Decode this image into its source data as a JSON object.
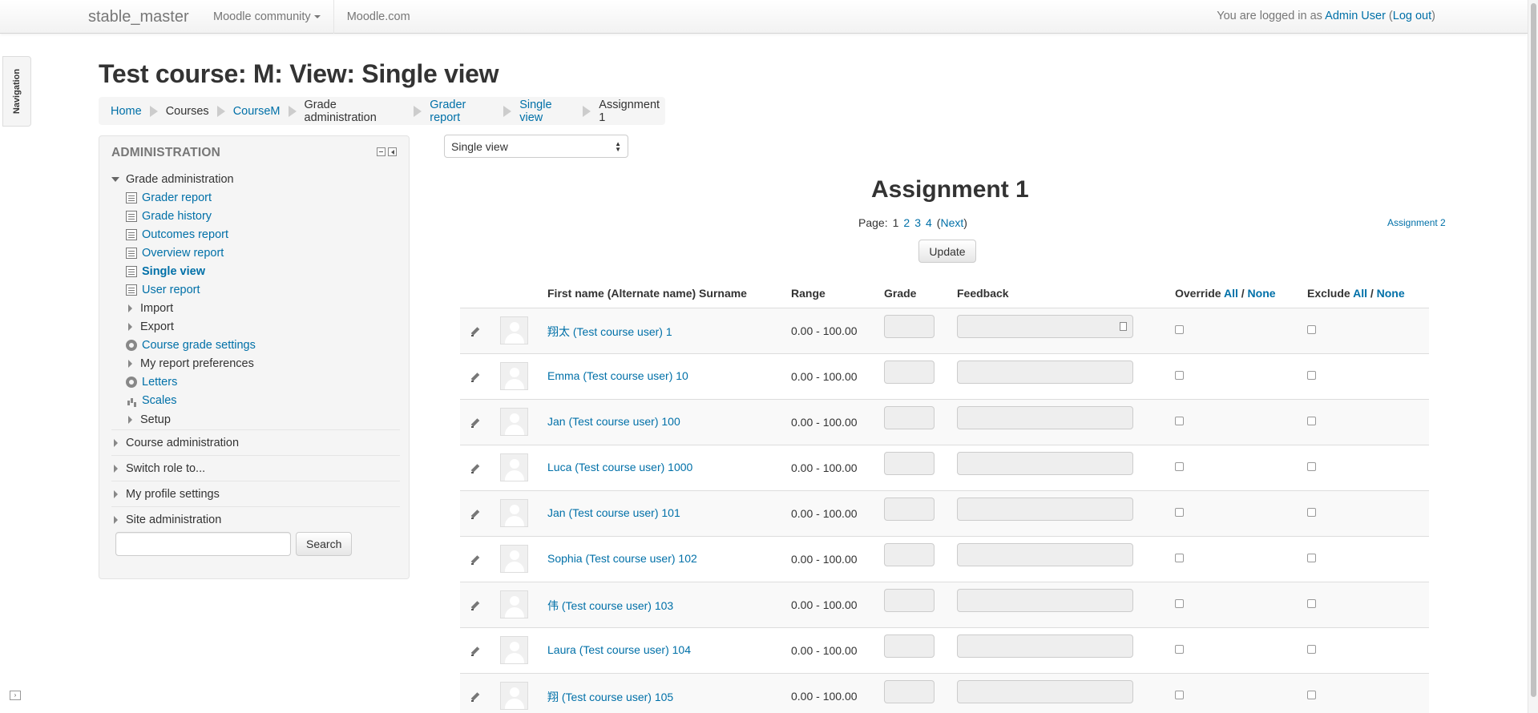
{
  "navbar": {
    "brand": "stable_master",
    "menu": [
      {
        "label": "Moodle community",
        "dropdown": true
      },
      {
        "label": "Moodle.com",
        "dropdown": false
      }
    ],
    "login_prefix": "You are logged in as ",
    "user": "Admin User",
    "logout": "Log out"
  },
  "nav_tab": {
    "label": "Navigation"
  },
  "page": {
    "title": "Test course: M: View: Single view"
  },
  "breadcrumb": [
    {
      "label": "Home",
      "link": true
    },
    {
      "label": "Courses",
      "link": false
    },
    {
      "label": "CourseM",
      "link": true
    },
    {
      "label": "Grade administration",
      "link": false
    },
    {
      "label": "Grader report",
      "link": true
    },
    {
      "label": "Single view",
      "link": true
    },
    {
      "label": "Assignment 1",
      "link": false
    }
  ],
  "admin": {
    "title": "ADMINISTRATION",
    "grade_admin": "Grade administration",
    "items": [
      {
        "label": "Grader report",
        "icon": "report-icon",
        "link": true
      },
      {
        "label": "Grade history",
        "icon": "report-icon",
        "link": true
      },
      {
        "label": "Outcomes report",
        "icon": "report-icon",
        "link": true
      },
      {
        "label": "Overview report",
        "icon": "report-icon",
        "link": true
      },
      {
        "label": "Single view",
        "icon": "report-icon",
        "link": true,
        "active": true
      },
      {
        "label": "User report",
        "icon": "report-icon",
        "link": true
      },
      {
        "label": "Import",
        "icon": "expand-arrow-icon",
        "link": false
      },
      {
        "label": "Export",
        "icon": "expand-arrow-icon",
        "link": false
      },
      {
        "label": "Course grade settings",
        "icon": "gear-icon",
        "link": true
      },
      {
        "label": "My report preferences",
        "icon": "expand-arrow-icon",
        "link": false
      },
      {
        "label": "Letters",
        "icon": "gear-icon",
        "link": true
      },
      {
        "label": "Scales",
        "icon": "bar-chart-icon",
        "link": true
      },
      {
        "label": "Setup",
        "icon": "expand-arrow-icon",
        "link": false
      }
    ],
    "sections": [
      "Course administration",
      "Switch role to...",
      "My profile settings",
      "Site administration"
    ],
    "search_button": "Search"
  },
  "main": {
    "view_select": "Single view",
    "item_title": "Assignment 1",
    "pager": {
      "label": "Page:",
      "current": "1",
      "pages": [
        "2",
        "3",
        "4"
      ],
      "next": "Next"
    },
    "next_item": "Assignment 2",
    "update_button": "Update"
  },
  "table": {
    "headers": {
      "name": "First name (Alternate name) Surname",
      "range": "Range",
      "grade": "Grade",
      "feedback": "Feedback",
      "override": "Override",
      "exclude": "Exclude",
      "all": "All",
      "none": "None",
      "sep": " / "
    },
    "rows": [
      {
        "name": "翔太 (Test course user) 1",
        "range": "0.00 - 100.00"
      },
      {
        "name": "Emma (Test course user) 10",
        "range": "0.00 - 100.00"
      },
      {
        "name": "Jan (Test course user) 100",
        "range": "0.00 - 100.00"
      },
      {
        "name": "Luca (Test course user) 1000",
        "range": "0.00 - 100.00"
      },
      {
        "name": "Jan (Test course user) 101",
        "range": "0.00 - 100.00"
      },
      {
        "name": "Sophia (Test course user) 102",
        "range": "0.00 - 100.00"
      },
      {
        "name": "伟 (Test course user) 103",
        "range": "0.00 - 100.00"
      },
      {
        "name": "Laura (Test course user) 104",
        "range": "0.00 - 100.00"
      },
      {
        "name": "翔 (Test course user) 105",
        "range": "0.00 - 100.00"
      }
    ]
  }
}
